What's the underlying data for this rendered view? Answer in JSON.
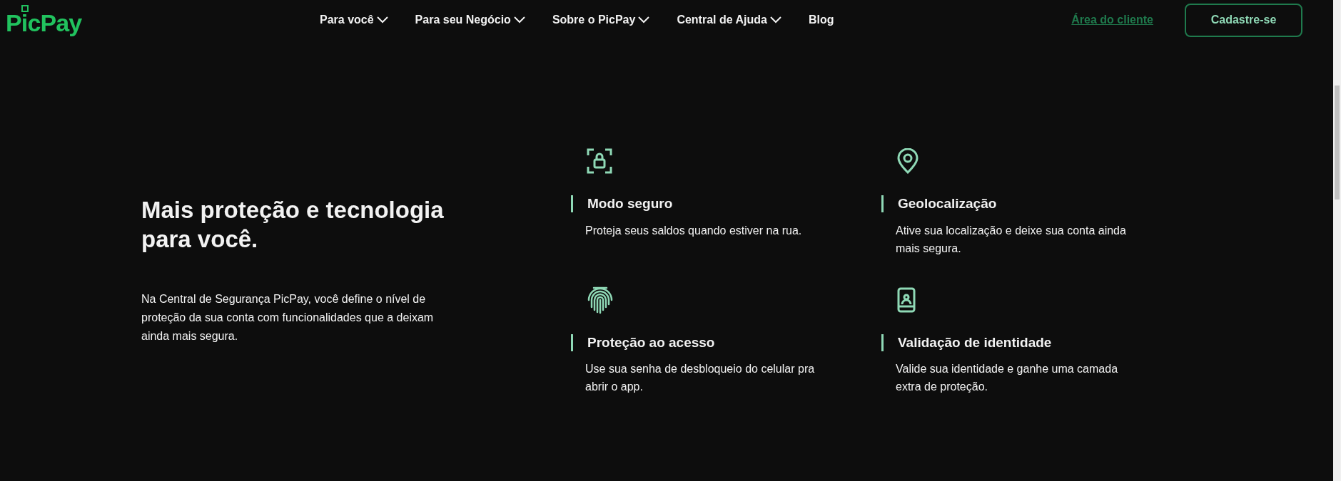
{
  "header": {
    "logo": "PicPay",
    "nav": [
      {
        "label": "Para você",
        "has_menu": true
      },
      {
        "label": "Para seu Negócio",
        "has_menu": true
      },
      {
        "label": "Sobre o PicPay",
        "has_menu": true
      },
      {
        "label": "Central de Ajuda",
        "has_menu": true
      },
      {
        "label": "Blog",
        "has_menu": false
      }
    ],
    "client_link": "Área do cliente",
    "signup_button": "Cadastre-se"
  },
  "intro": {
    "title": "Mais proteção e tecnologia para você.",
    "text": "Na Central de Segurança PicPay, você define o nível de proteção da sua conta com funcionalidades que a deixam ainda mais segura."
  },
  "features": [
    {
      "kind": "lock",
      "title": "Modo seguro",
      "text": "Proteja seus saldos quando estiver na rua."
    },
    {
      "kind": "pin",
      "title": "Geolocalização",
      "text": "Ative sua localização e deixe sua conta ainda mais segura."
    },
    {
      "kind": "fingerprint",
      "title": "Proteção ao acesso",
      "text": "Use sua senha de desbloqueio do celular pra abrir o app."
    },
    {
      "kind": "badge",
      "title": "Validação de identidade",
      "text": "Valide sua identidade e ganhe uma camada extra de proteção."
    }
  ]
}
